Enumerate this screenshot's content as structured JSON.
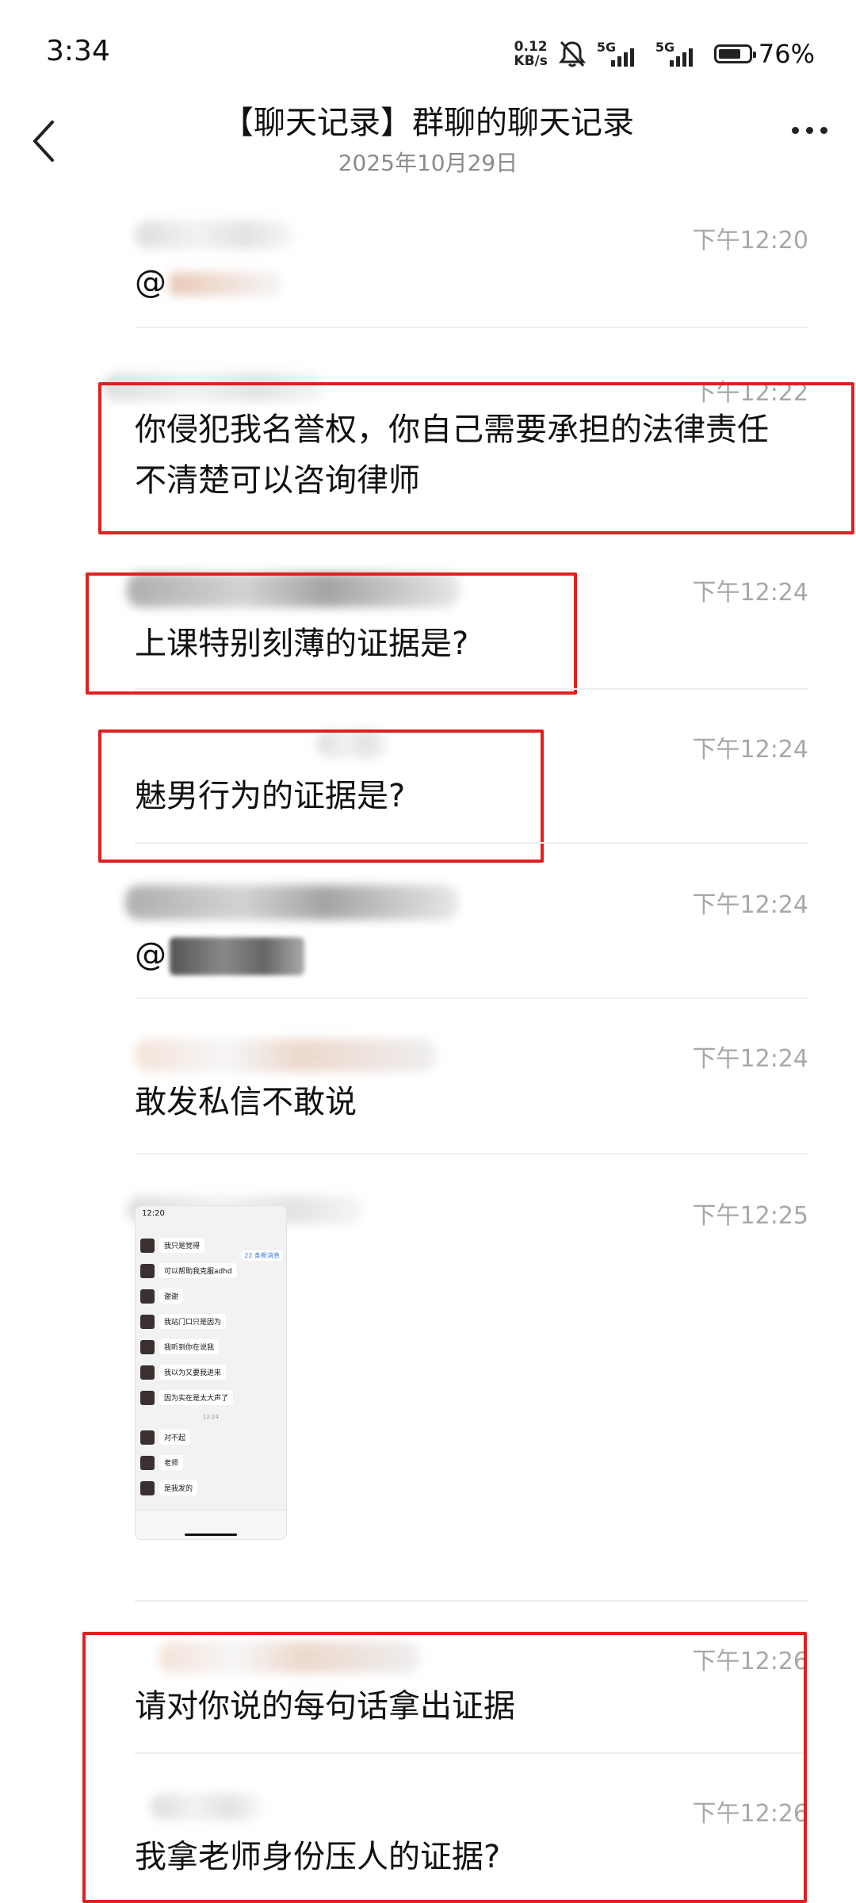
{
  "status_bar": {
    "time": "3:34",
    "net_speed_value": "0.12",
    "net_speed_unit": "KB/s",
    "sim1_label": "5G",
    "sim2_label": "5G",
    "battery_text": "76%",
    "battery_level_percent": 76
  },
  "header": {
    "title": "【聊天记录】群聊的聊天记录",
    "subtitle": "2025年10月29日"
  },
  "messages": [
    {
      "time": "下午12:20",
      "text": "@"
    },
    {
      "time": "下午12:22",
      "text": "你侵犯我名誉权，你自己需要承担的法律责任不清楚可以咨询律师"
    },
    {
      "time": "下午12:24",
      "text": "上课特别刻薄的证据是?"
    },
    {
      "time": "下午12:24",
      "text": "魅男行为的证据是?"
    },
    {
      "time": "下午12:24",
      "text": "@"
    },
    {
      "time": "下午12:24",
      "text": "敢发私信不敢说"
    },
    {
      "time": "下午12:25",
      "text": ""
    },
    {
      "time": "下午12:26",
      "text": "请对你说的每句话拿出证据"
    },
    {
      "time": "下午12:26",
      "text": "我拿老师身份压人的证据?"
    }
  ],
  "embedded_screenshot": {
    "time": "12:20",
    "badge": "22 条新消息",
    "timestamp": "12:24",
    "bubbles": [
      "我只是觉得",
      "可以帮助我克服adhd",
      "谢谢",
      "我站门口只是因为",
      "我听到你在说我",
      "我以为又要我进来",
      "因为实在是太大声了",
      "对不起",
      "老师",
      "是我发的"
    ]
  }
}
